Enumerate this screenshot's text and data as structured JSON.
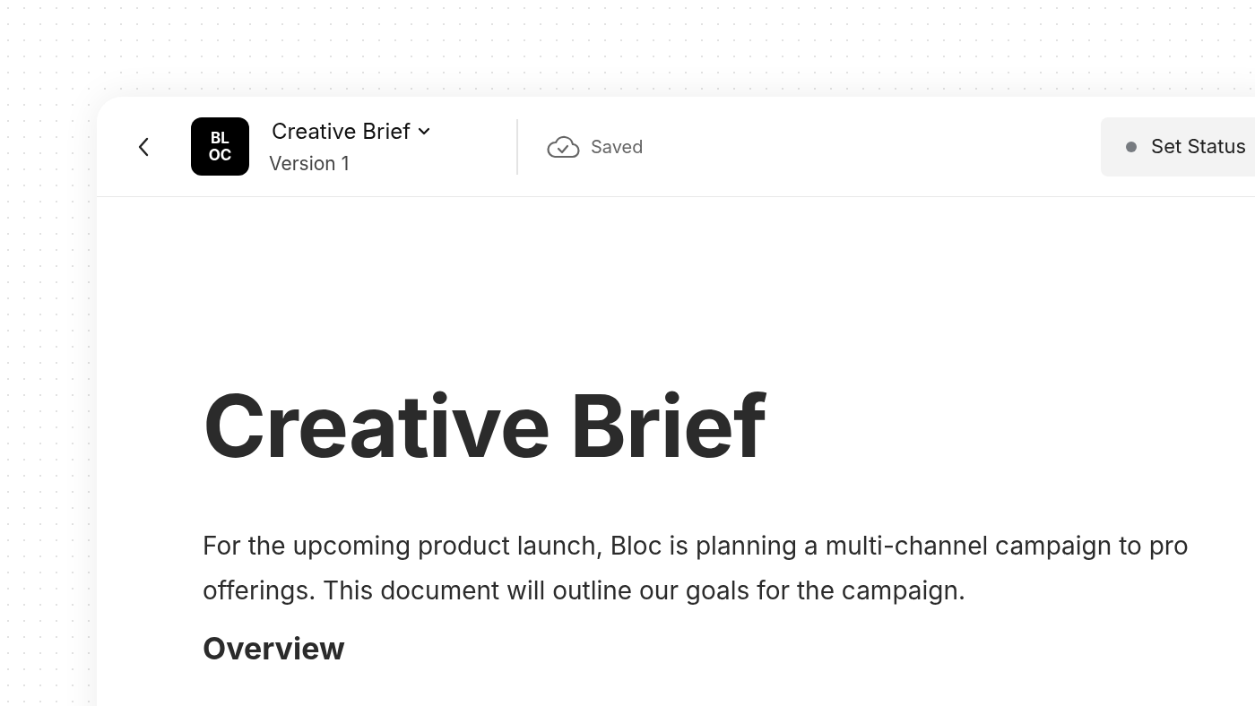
{
  "header": {
    "logo_lines": [
      "BL",
      "OC"
    ],
    "title": "Creative Brief",
    "version": "Version 1",
    "save_state": "Saved",
    "status_button": "Set Status"
  },
  "document": {
    "title": "Creative Brief",
    "intro": [
      "For the upcoming product launch, Bloc is planning a multi-channel campaign to pro",
      "offerings. This document will outline our goals for the campaign."
    ],
    "section_heading": "Overview"
  }
}
